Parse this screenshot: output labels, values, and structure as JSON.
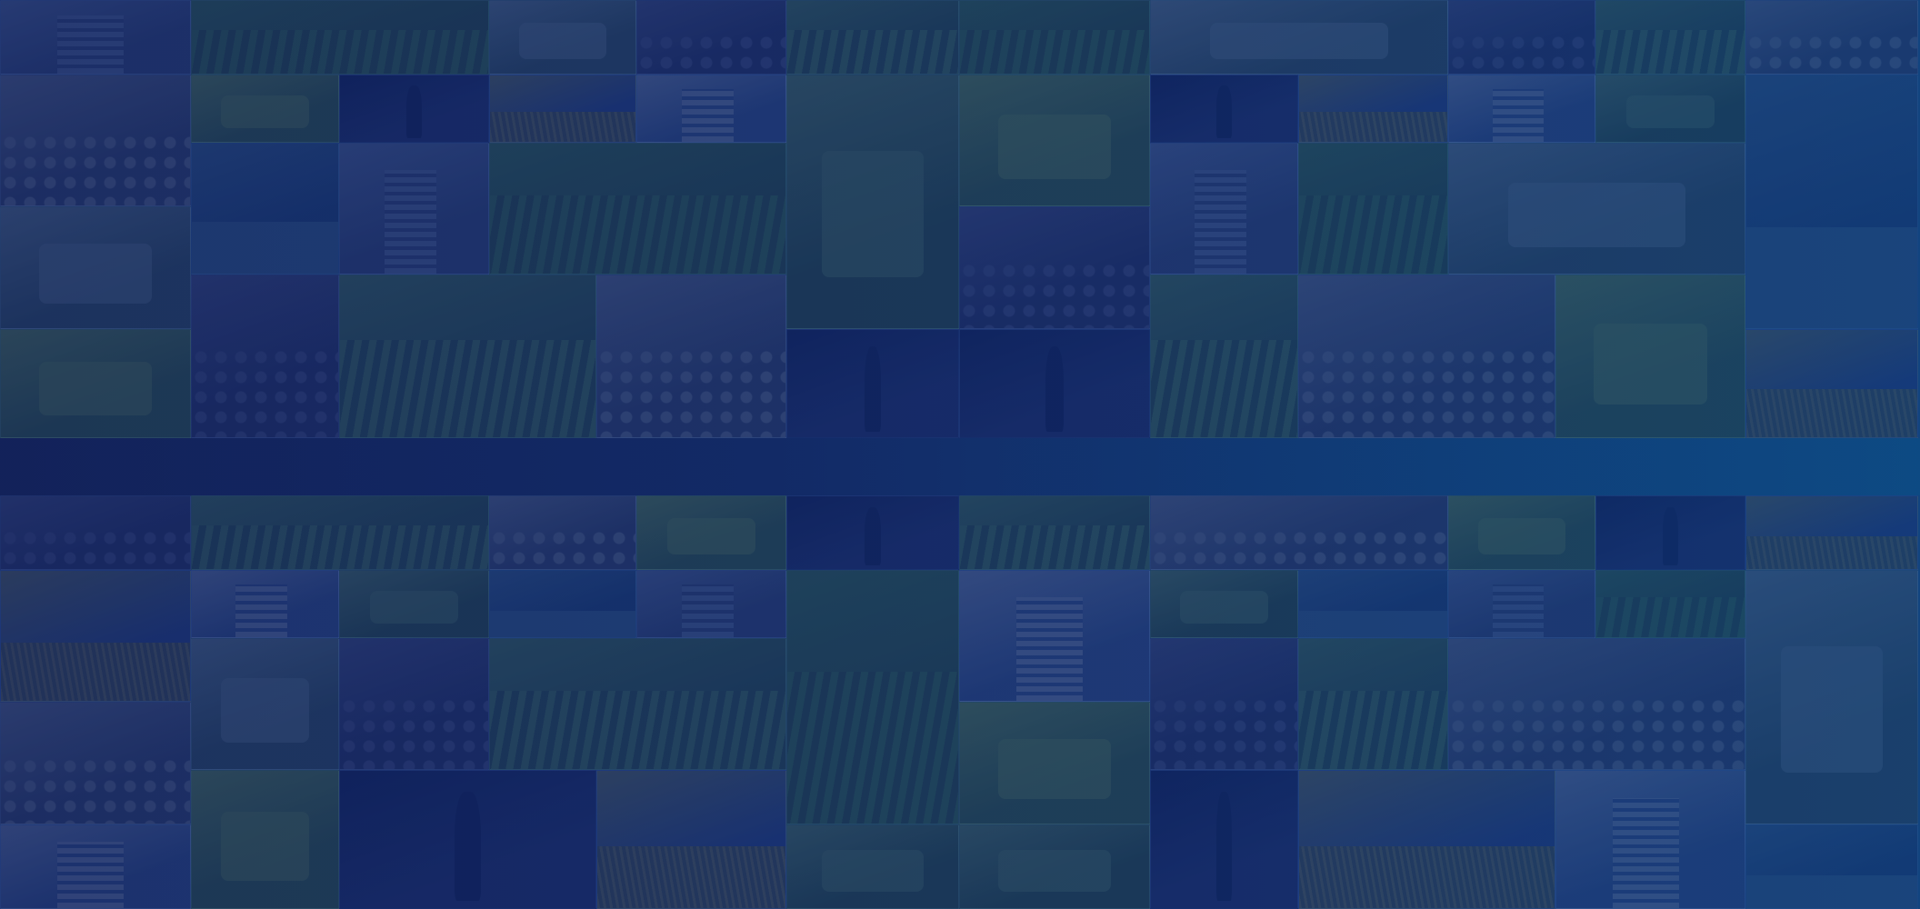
{
  "background": {
    "description_colors": {
      "base": "#13235a",
      "mid": "#132a66",
      "right": "#0f4c84",
      "tint": "#0e2258"
    },
    "tiles": [
      {
        "theme": "building",
        "color": "#3a4f8a",
        "accent": "#5d76b0"
      },
      {
        "theme": "field",
        "color": "#2f5a4a",
        "accent": "#3d7a55"
      },
      {
        "theme": "tractor",
        "color": "#3a5c6a",
        "accent": "#6b8aa0"
      },
      {
        "theme": "crowd",
        "color": "#2a3570",
        "accent": "#4a5590"
      },
      {
        "theme": "rows",
        "color": "#2f5a50",
        "accent": "#4a8060"
      },
      {
        "theme": "people",
        "color": "#3a4a7a",
        "accent": "#6a7aa0"
      },
      {
        "theme": "vegetables",
        "color": "#3a6a4a",
        "accent": "#6a9a5a"
      },
      {
        "theme": "silhouette",
        "color": "#24347a",
        "accent": "#102060"
      },
      {
        "theme": "wheat-sky",
        "color": "#2a4a9a",
        "accent": "#6a7a6a"
      },
      {
        "theme": "tower",
        "color": "#3a5aa0",
        "accent": "#7a90c0"
      },
      {
        "theme": "sprayer",
        "color": "#2f5a4a",
        "accent": "#5a8a6a"
      },
      {
        "theme": "sea",
        "color": "#1f4a8a",
        "accent": "#3a6aa0"
      }
    ]
  }
}
